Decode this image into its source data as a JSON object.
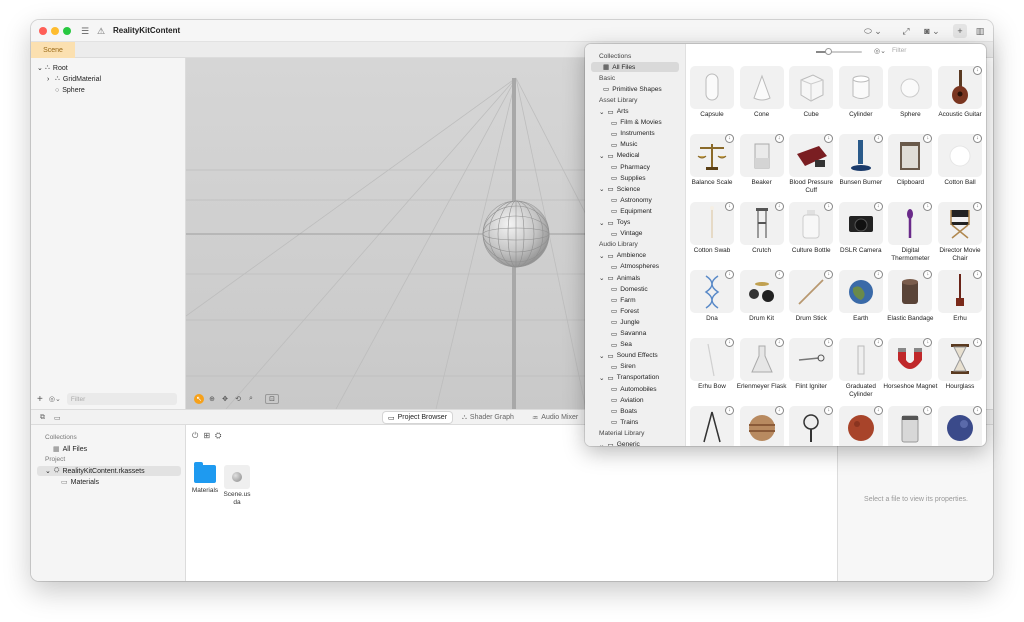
{
  "window": {
    "title": "RealityKitContent",
    "scene_tab": "Scene"
  },
  "titlebar_icons": {
    "sidebar": "sidebar-icon",
    "warning": "warning-icon",
    "add": "+"
  },
  "outline": {
    "items": [
      {
        "label": "Root",
        "indent": 0,
        "chev": "⌄"
      },
      {
        "label": "GridMaterial",
        "indent": 1,
        "chev": "›"
      },
      {
        "label": "Sphere",
        "indent": 1,
        "chev": ""
      }
    ],
    "filter_placeholder": "Filter"
  },
  "bottom_tabs": [
    {
      "label": "Project Browser",
      "active": true
    },
    {
      "label": "Shader Graph",
      "active": false
    },
    {
      "label": "Audio Mixer",
      "active": false
    }
  ],
  "project": {
    "collections_header": "Collections",
    "all_files": "All Files",
    "project_header": "Project",
    "package": "RealityKitContent.rkassets",
    "materials": "Materials",
    "files": [
      {
        "name": "Materials",
        "kind": "folder"
      },
      {
        "name": "Scene.usda",
        "kind": "scene"
      }
    ]
  },
  "inspector": {
    "empty_text": "Select a file to view its properties."
  },
  "library": {
    "filter_placeholder": "Filter",
    "sidebar": [
      {
        "label": "Collections",
        "type": "head",
        "indent": 0
      },
      {
        "label": "All Files",
        "type": "item",
        "indent": 1,
        "selected": true
      },
      {
        "label": "Basic",
        "type": "head",
        "indent": 0
      },
      {
        "label": "Primitive Shapes",
        "type": "item",
        "indent": 1
      },
      {
        "label": "Asset Library",
        "type": "head",
        "indent": 0
      },
      {
        "label": "Arts",
        "type": "group",
        "indent": 0
      },
      {
        "label": "Film & Movies",
        "type": "item",
        "indent": 2
      },
      {
        "label": "Instruments",
        "type": "item",
        "indent": 2
      },
      {
        "label": "Music",
        "type": "item",
        "indent": 2
      },
      {
        "label": "Medical",
        "type": "group",
        "indent": 0
      },
      {
        "label": "Pharmacy",
        "type": "item",
        "indent": 2
      },
      {
        "label": "Supplies",
        "type": "item",
        "indent": 2
      },
      {
        "label": "Science",
        "type": "group",
        "indent": 0
      },
      {
        "label": "Astronomy",
        "type": "item",
        "indent": 2
      },
      {
        "label": "Equipment",
        "type": "item",
        "indent": 2
      },
      {
        "label": "Toys",
        "type": "group",
        "indent": 0
      },
      {
        "label": "Vintage",
        "type": "item",
        "indent": 2
      },
      {
        "label": "Audio Library",
        "type": "head",
        "indent": 0
      },
      {
        "label": "Ambience",
        "type": "group",
        "indent": 0
      },
      {
        "label": "Atmospheres",
        "type": "item",
        "indent": 2
      },
      {
        "label": "Animals",
        "type": "group",
        "indent": 0
      },
      {
        "label": "Domestic",
        "type": "item",
        "indent": 2
      },
      {
        "label": "Farm",
        "type": "item",
        "indent": 2
      },
      {
        "label": "Forest",
        "type": "item",
        "indent": 2
      },
      {
        "label": "Jungle",
        "type": "item",
        "indent": 2
      },
      {
        "label": "Savanna",
        "type": "item",
        "indent": 2
      },
      {
        "label": "Sea",
        "type": "item",
        "indent": 2
      },
      {
        "label": "Sound Effects",
        "type": "group",
        "indent": 0
      },
      {
        "label": "Siren",
        "type": "item",
        "indent": 2
      },
      {
        "label": "Transportation",
        "type": "group",
        "indent": 0
      },
      {
        "label": "Automobiles",
        "type": "item",
        "indent": 2
      },
      {
        "label": "Aviation",
        "type": "item",
        "indent": 2
      },
      {
        "label": "Boats",
        "type": "item",
        "indent": 2
      },
      {
        "label": "Trains",
        "type": "item",
        "indent": 2
      },
      {
        "label": "Material Library",
        "type": "head",
        "indent": 0
      },
      {
        "label": "Generic",
        "type": "group",
        "indent": 0
      }
    ],
    "assets": [
      {
        "name": "Capsule",
        "icon": "capsule-icon",
        "download": false
      },
      {
        "name": "Cone",
        "icon": "cone-icon",
        "download": false
      },
      {
        "name": "Cube",
        "icon": "cube-icon",
        "download": false
      },
      {
        "name": "Cylinder",
        "icon": "cylinder-icon",
        "download": false
      },
      {
        "name": "Sphere",
        "icon": "sphere-icon",
        "download": false
      },
      {
        "name": "Acoustic Guitar",
        "icon": "guitar-icon",
        "download": true
      },
      {
        "name": "Balance Scale",
        "icon": "scale-icon",
        "download": true
      },
      {
        "name": "Beaker",
        "icon": "beaker-icon",
        "download": true
      },
      {
        "name": "Blood Pressure Cuff",
        "icon": "cuff-icon",
        "download": true
      },
      {
        "name": "Bunsen Burner",
        "icon": "burner-icon",
        "download": true
      },
      {
        "name": "Clipboard",
        "icon": "clipboard-icon",
        "download": true
      },
      {
        "name": "Cotton Ball",
        "icon": "cotton-ball-icon",
        "download": true
      },
      {
        "name": "Cotton Swab",
        "icon": "swab-icon",
        "download": true
      },
      {
        "name": "Crutch",
        "icon": "crutch-icon",
        "download": true
      },
      {
        "name": "Culture Bottle",
        "icon": "bottle-icon",
        "download": true
      },
      {
        "name": "DSLR Camera",
        "icon": "camera-icon",
        "download": true
      },
      {
        "name": "Digital Thermometer",
        "icon": "thermometer-icon",
        "download": true
      },
      {
        "name": "Director Movie Chair",
        "icon": "chair-icon",
        "download": true
      },
      {
        "name": "Dna",
        "icon": "dna-icon",
        "download": true
      },
      {
        "name": "Drum Kit",
        "icon": "drum-icon",
        "download": true
      },
      {
        "name": "Drum Stick",
        "icon": "drumstick-icon",
        "download": true
      },
      {
        "name": "Earth",
        "icon": "earth-icon",
        "download": true
      },
      {
        "name": "Elastic Bandage",
        "icon": "bandage-icon",
        "download": true
      },
      {
        "name": "Erhu",
        "icon": "erhu-icon",
        "download": true
      },
      {
        "name": "Erhu Bow",
        "icon": "bow-icon",
        "download": true
      },
      {
        "name": "Erlenmeyer Flask",
        "icon": "flask-icon",
        "download": true
      },
      {
        "name": "Flint Igniter",
        "icon": "igniter-icon",
        "download": true
      },
      {
        "name": "Graduated Cylinder",
        "icon": "graduated-cylinder-icon",
        "download": true
      },
      {
        "name": "Horseshoe Magnet",
        "icon": "magnet-icon",
        "download": true
      },
      {
        "name": "Hourglass",
        "icon": "hourglass-icon",
        "download": true
      },
      {
        "name": "",
        "icon": "compass-icon",
        "download": true
      },
      {
        "name": "",
        "icon": "jupiter-icon",
        "download": true
      },
      {
        "name": "",
        "icon": "magnifier-icon",
        "download": true
      },
      {
        "name": "",
        "icon": "mars-icon",
        "download": true
      },
      {
        "name": "",
        "icon": "jar-icon",
        "download": true
      },
      {
        "name": "",
        "icon": "neptune-icon",
        "download": true
      }
    ]
  }
}
